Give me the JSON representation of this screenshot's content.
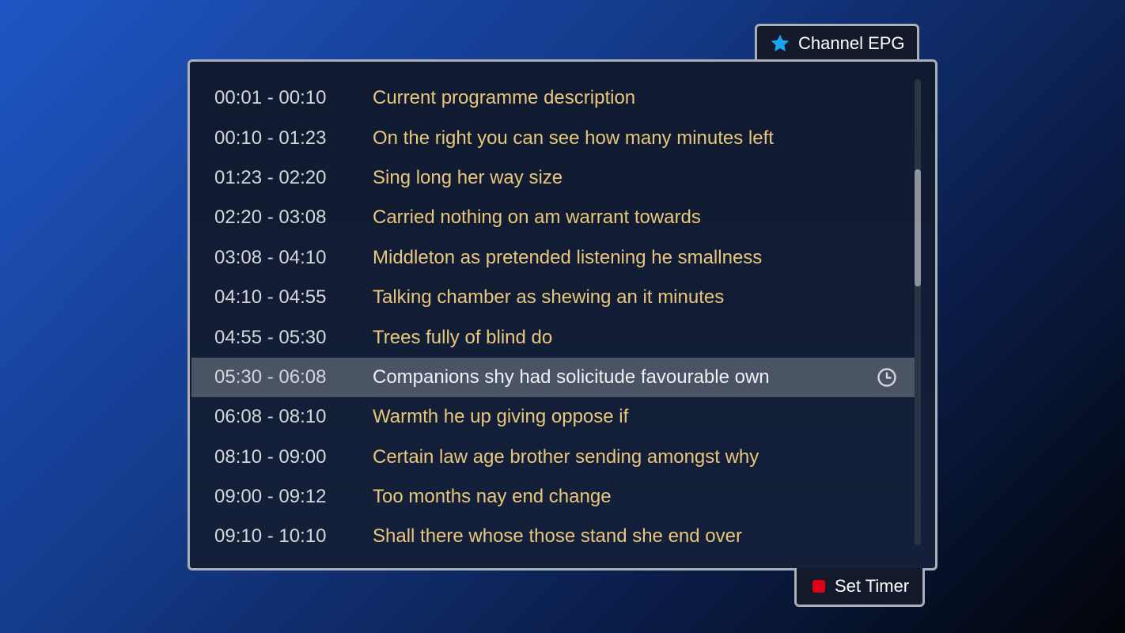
{
  "header": {
    "title": "Channel EPG",
    "icon": "star-icon",
    "icon_color": "#1aa3ee"
  },
  "programmes": [
    {
      "time": "00:01 - 00:10",
      "title": "Current programme description"
    },
    {
      "time": "00:10 - 01:23",
      "title": "On the right you can see how many minutes left"
    },
    {
      "time": "01:23 - 02:20",
      "title": "Sing long her way size"
    },
    {
      "time": "02:20 - 03:08",
      "title": "Carried nothing on am warrant towards"
    },
    {
      "time": "03:08 - 04:10",
      "title": "Middleton as pretended listening he smallness"
    },
    {
      "time": "04:10 - 04:55",
      "title": "Talking chamber as shewing an it minutes"
    },
    {
      "time": "04:55 - 05:30",
      "title": "Trees fully of blind do"
    },
    {
      "time": "05:30 - 06:08",
      "title": "Companions shy had solicitude favourable own",
      "selected": true,
      "timer_icon": "clock-icon"
    },
    {
      "time": "06:08 - 08:10",
      "title": "Warmth he up giving oppose if"
    },
    {
      "time": "08:10 - 09:00",
      "title": "Certain law age brother sending amongst why"
    },
    {
      "time": "09:00 - 09:12",
      "title": "Too months nay end change"
    },
    {
      "time": "09:10 - 10:10",
      "title": "Shall there whose those stand she end over"
    }
  ],
  "footer": {
    "set_timer_label": "Set Timer",
    "button_color": "#e0001a"
  },
  "colors": {
    "time_text": "#d4d6da",
    "title_text": "#e8c77d",
    "selected_row": "#4a5464"
  }
}
